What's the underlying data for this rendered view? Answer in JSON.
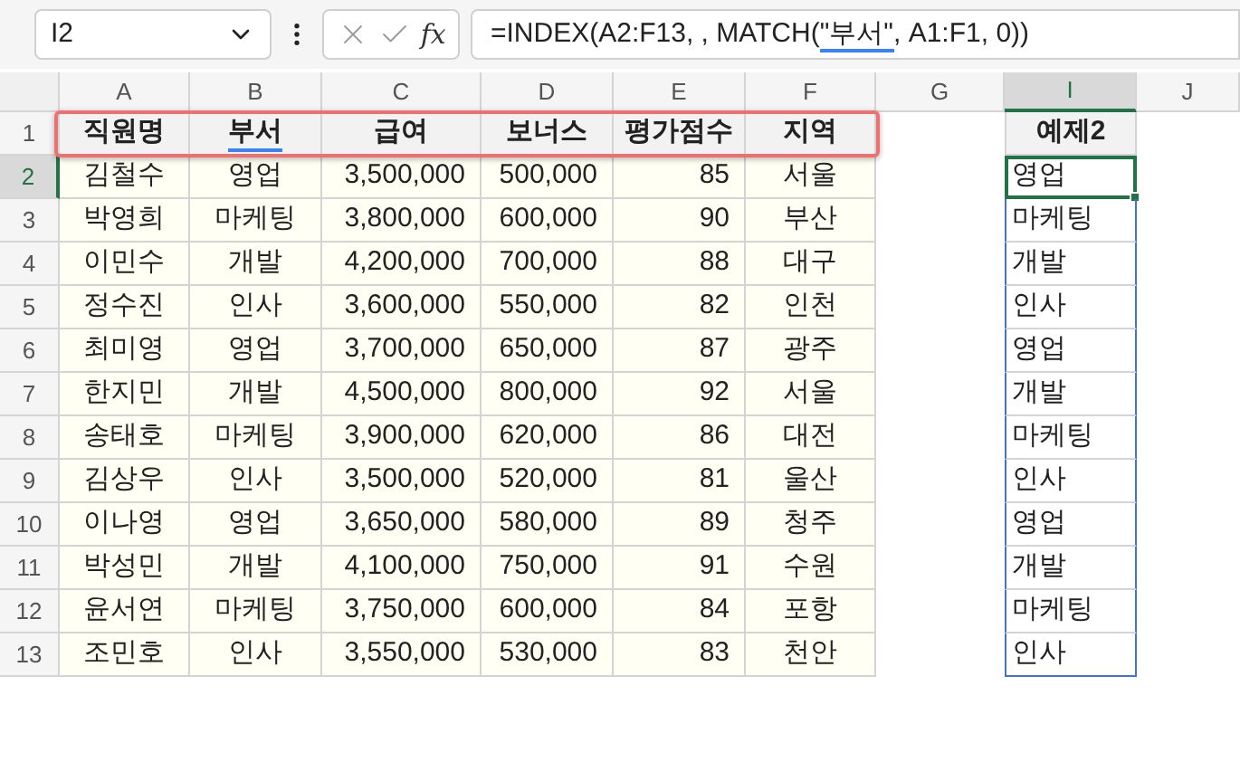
{
  "name_box": "I2",
  "function_label": "fx",
  "formula": {
    "before": "=INDEX(A2:F13, , MATCH(",
    "underlined": "\"부서\"",
    "after": ", A1:F1, 0))"
  },
  "columns": [
    {
      "label": "A",
      "selected": false
    },
    {
      "label": "B",
      "selected": false
    },
    {
      "label": "C",
      "selected": false
    },
    {
      "label": "D",
      "selected": false
    },
    {
      "label": "E",
      "selected": false
    },
    {
      "label": "F",
      "selected": false
    },
    {
      "label": "G",
      "selected": false
    },
    {
      "label": "I",
      "selected": true
    },
    {
      "label": "J",
      "selected": false
    }
  ],
  "headers": [
    {
      "text": "직원명",
      "underlined": false
    },
    {
      "text": "부서",
      "underlined": true
    },
    {
      "text": "급여",
      "underlined": false
    },
    {
      "text": "보너스",
      "underlined": false
    },
    {
      "text": "평가점수",
      "underlined": false
    },
    {
      "text": "지역",
      "underlined": false
    }
  ],
  "example_header": "예제2",
  "header_row_number": "1",
  "rows": [
    {
      "number": "2",
      "selected": true,
      "cells": [
        "김철수",
        "영업",
        "3,500,000",
        "500,000",
        "85",
        "서울"
      ],
      "example": "영업"
    },
    {
      "number": "3",
      "selected": false,
      "cells": [
        "박영희",
        "마케팅",
        "3,800,000",
        "600,000",
        "90",
        "부산"
      ],
      "example": "마케팅"
    },
    {
      "number": "4",
      "selected": false,
      "cells": [
        "이민수",
        "개발",
        "4,200,000",
        "700,000",
        "88",
        "대구"
      ],
      "example": "개발"
    },
    {
      "number": "5",
      "selected": false,
      "cells": [
        "정수진",
        "인사",
        "3,600,000",
        "550,000",
        "82",
        "인천"
      ],
      "example": "인사"
    },
    {
      "number": "6",
      "selected": false,
      "cells": [
        "최미영",
        "영업",
        "3,700,000",
        "650,000",
        "87",
        "광주"
      ],
      "example": "영업"
    },
    {
      "number": "7",
      "selected": false,
      "cells": [
        "한지민",
        "개발",
        "4,500,000",
        "800,000",
        "92",
        "서울"
      ],
      "example": "개발"
    },
    {
      "number": "8",
      "selected": false,
      "cells": [
        "송태호",
        "마케팅",
        "3,900,000",
        "620,000",
        "86",
        "대전"
      ],
      "example": "마케팅"
    },
    {
      "number": "9",
      "selected": false,
      "cells": [
        "김상우",
        "인사",
        "3,500,000",
        "520,000",
        "81",
        "울산"
      ],
      "example": "인사"
    },
    {
      "number": "10",
      "selected": false,
      "cells": [
        "이나영",
        "영업",
        "3,650,000",
        "580,000",
        "89",
        "청주"
      ],
      "example": "영업"
    },
    {
      "number": "11",
      "selected": false,
      "cells": [
        "박성민",
        "개발",
        "4,100,000",
        "750,000",
        "91",
        "수원"
      ],
      "example": "개발"
    },
    {
      "number": "12",
      "selected": false,
      "cells": [
        "윤서연",
        "마케팅",
        "3,750,000",
        "600,000",
        "84",
        "포항"
      ],
      "example": "마케팅"
    },
    {
      "number": "13",
      "selected": false,
      "cells": [
        "조민호",
        "인사",
        "3,550,000",
        "530,000",
        "83",
        "천안"
      ],
      "example": "인사"
    }
  ]
}
